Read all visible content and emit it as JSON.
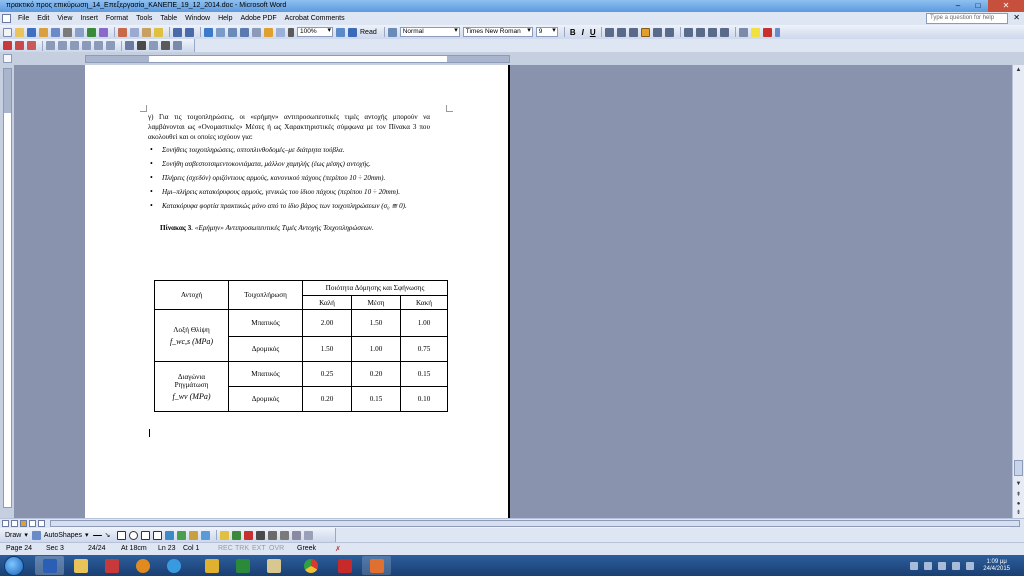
{
  "window": {
    "title": "πρακτικό προς επικύρωση_14_Επεξεργασία_ΚΑΝΕΠΕ_19_12_2014.doc - Microsoft Word"
  },
  "menu": [
    "File",
    "Edit",
    "View",
    "Insert",
    "Format",
    "Tools",
    "Table",
    "Window",
    "Help",
    "Adobe PDF",
    "Acrobat Comments"
  ],
  "help_placeholder": "Type a question for help",
  "toolbar": {
    "zoom": "100%",
    "read": "Read",
    "style": "Normal",
    "font": "Times New Roman",
    "size": "9",
    "bold": "B",
    "italic": "I",
    "underline": "U"
  },
  "document": {
    "paragraph": "γ) Για τις τοιχοπληρώσεις, οι «ερήμην» αντιπροσωπευτικές τιμές αντοχής μπορούν να λαμβάνονται ως «Ονομαστικές» Μέσες ή ως Χαρακτηριστικές σύμφωνα με τον Πίνακα 3 που ακολουθεί και οι οποίες ισχύουν για:",
    "bullets": [
      "Συνήθεις τοιχοπληρώσεις, οπτοπλινθοδομές–με διάτρητα τούβλα.",
      "Συνήθη ασβεστοτσιμεντοκονιάματα, μάλλον χαμηλής (έως μέσης) αντοχής.",
      "Πλήρεις (σχεδόν) οριζόντιους αρμούς, κανονικού πάχους (περίπου 10 ÷ 20mm).",
      "Ημι–πλήρεις κατακόρυφους αρμούς, γενικώς του ίδιου πάχους (περίπου 10 ÷ 20mm).",
      "Κατακόρυφα φορτία πρακτικώς μόνο από το ίδιο βάρος των τοιχοπληρώσεων (σ₀ ≅ 0)."
    ],
    "caption_bold": "Πίνακας 3",
    "caption_italic": ". «Ερήμην» Αντιπροσωπευτικές Τιμές Αντοχής Τοιχοπληρώσεων.",
    "table": {
      "col_resistance": "Αντοχή",
      "col_infill": "Τοιχοπλήρωση",
      "col_quality": "Ποιότητα Δόμησης και Σφήνωσης",
      "q_good": "Καλή",
      "q_medium": "Μέση",
      "q_bad": "Κακή",
      "group1_line1": "Λοξή Θλίψη",
      "group1_formula": "f_wc,s (MPa)",
      "group2_line1": "Διαγώνια",
      "group2_line2": "Ρηγμάτωση",
      "group2_formula": "f_wv (MPa)",
      "rows": [
        [
          "Μπατικός",
          "2.00",
          "1.50",
          "1.00"
        ],
        [
          "Δρομικός",
          "1.50",
          "1.00",
          "0.75"
        ],
        [
          "Μπατικός",
          "0.25",
          "0.20",
          "0.15"
        ],
        [
          "Δρομικός",
          "0.20",
          "0.15",
          "0.10"
        ]
      ]
    }
  },
  "drawbar": {
    "draw": "Draw",
    "autoshapes": "AutoShapes"
  },
  "status": {
    "page": "Page 24",
    "sec": "Sec 3",
    "pages": "24/24",
    "at": "At 18cm",
    "ln": "Ln 23",
    "col": "Col 1",
    "rec": "REC",
    "trk": "TRK",
    "ext": "EXT",
    "ovr": "OVR",
    "lang": "Greek"
  },
  "clock": {
    "time": "1:09 μμ",
    "date": "24/4/2015"
  },
  "colors": {
    "taskbar": "#1f4a82",
    "accent": "#5c9adf"
  }
}
